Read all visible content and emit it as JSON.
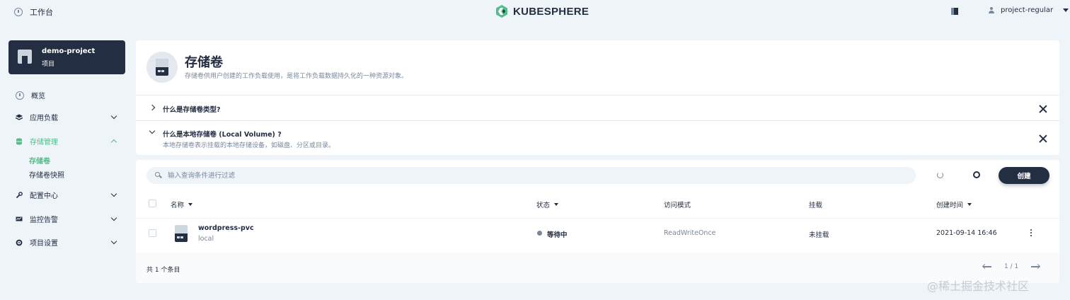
{
  "topbar": {
    "workbench_label": "工作台",
    "brand": "KUBESPHERE",
    "user": "project-regular"
  },
  "sidebar": {
    "project": {
      "name": "demo-project",
      "type": "项目"
    },
    "items": [
      {
        "label": "概览"
      },
      {
        "label": "应用负载"
      },
      {
        "label": "存储管理"
      },
      {
        "label": "配置中心"
      },
      {
        "label": "监控告警"
      },
      {
        "label": "项目设置"
      }
    ],
    "storage_sub": [
      {
        "label": "存储卷"
      },
      {
        "label": "存储卷快照"
      }
    ]
  },
  "header": {
    "title": "存储卷",
    "description": "存储卷供用户创建的工作负载使用，是将工作负载数据持久化的一种资源对象。"
  },
  "faq": [
    {
      "title": "什么是存储卷类型?",
      "expanded": false
    },
    {
      "title": "什么是本地存储卷 (Local Volume) ?",
      "expanded": true,
      "description": "本地存储卷表示挂载的本地存储设备，如磁盘、分区或目录。"
    }
  ],
  "toolbar": {
    "search_placeholder": "输入查询条件进行过滤",
    "create_label": "创建"
  },
  "table": {
    "columns": [
      "名称",
      "状态",
      "访问模式",
      "挂载",
      "创建时间"
    ],
    "rows": [
      {
        "name": "wordpress-pvc",
        "storage_class": "local",
        "status": "等待中",
        "access_mode": "ReadWriteOnce",
        "mount": "未挂载",
        "created": "2021-09-14 16:46"
      }
    ]
  },
  "footer": {
    "total": "共 1 个条目",
    "page": "1 / 1"
  },
  "watermark": "@稀土掘金技术社区",
  "colors": {
    "accent": "#55bc8a",
    "dark": "#242e42",
    "muted": "#79879c",
    "background": "#eff4f9"
  }
}
